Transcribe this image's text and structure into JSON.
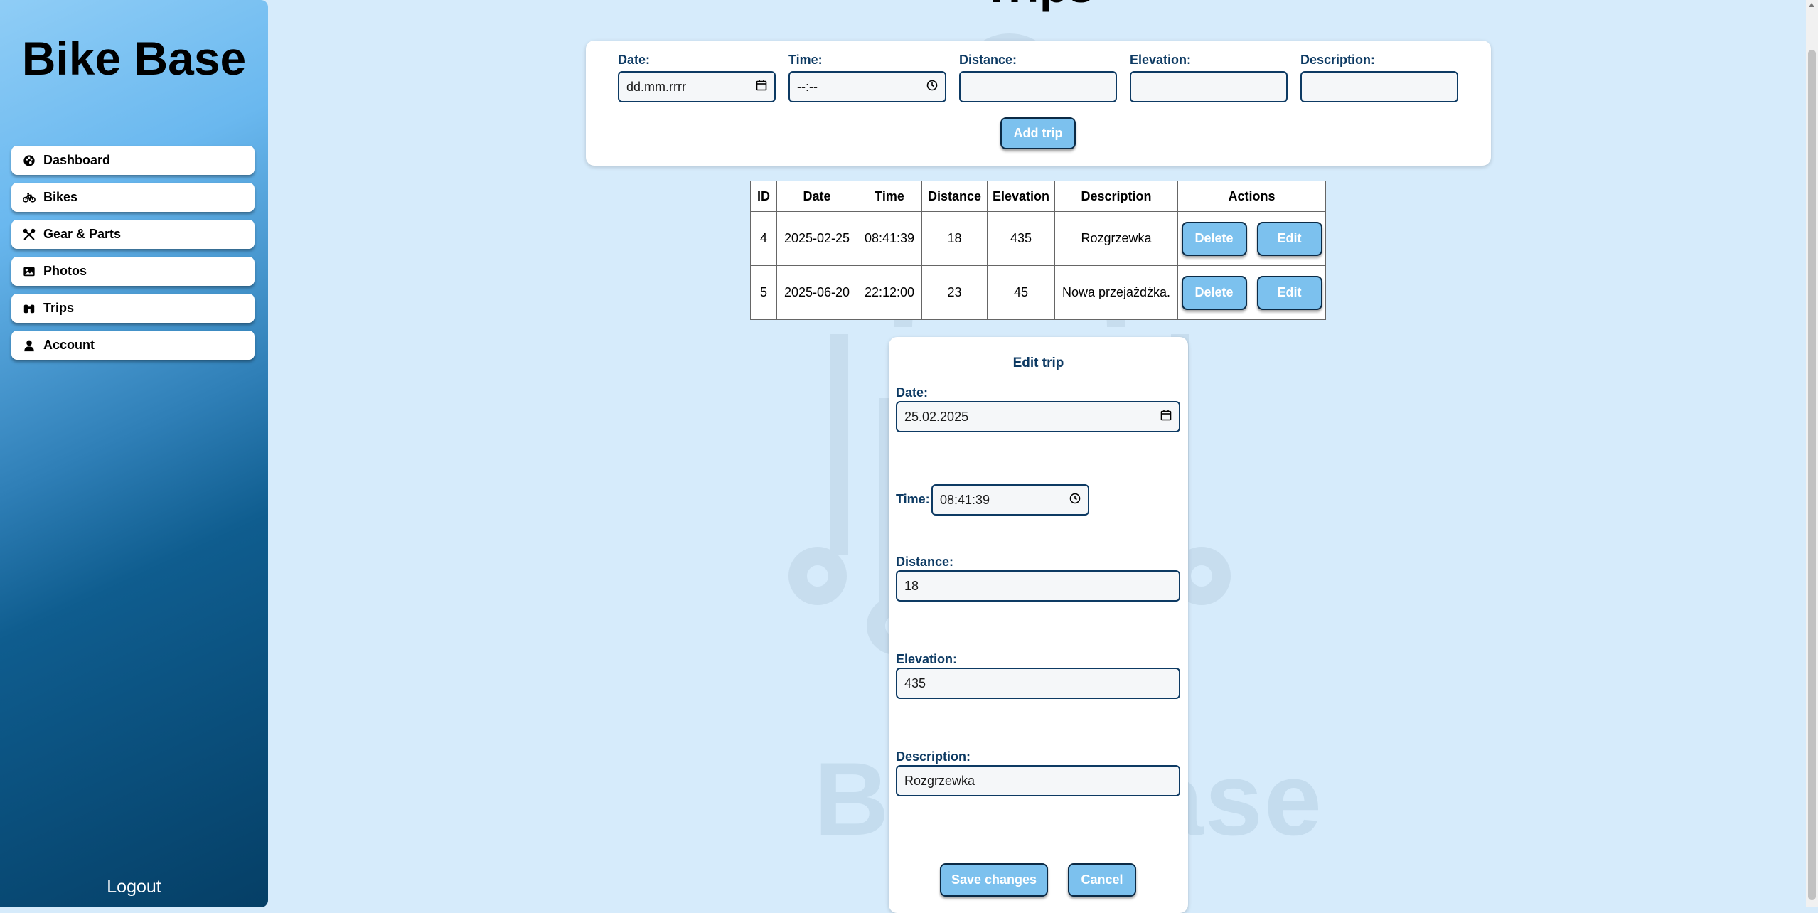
{
  "app": {
    "brand": "Bike Base",
    "page_title": "Trips",
    "watermark_text": "Bike Base"
  },
  "sidebar": {
    "items": [
      {
        "label": "Dashboard",
        "icon": "palette-icon"
      },
      {
        "label": "Bikes",
        "icon": "bicycle-icon"
      },
      {
        "label": "Gear & Parts",
        "icon": "tools-icon"
      },
      {
        "label": "Photos",
        "icon": "image-icon"
      },
      {
        "label": "Trips",
        "icon": "binoculars-icon"
      },
      {
        "label": "Account",
        "icon": "user-icon"
      }
    ],
    "logout": "Logout"
  },
  "add_form": {
    "date_label": "Date:",
    "date_value": "dd.mm.rrrr",
    "time_label": "Time:",
    "time_value": "--:--",
    "distance_label": "Distance:",
    "distance_value": "",
    "elevation_label": "Elevation:",
    "elevation_value": "",
    "description_label": "Description:",
    "description_value": "",
    "submit": "Add trip"
  },
  "table": {
    "headers": [
      "ID",
      "Date",
      "Time",
      "Distance",
      "Elevation",
      "Description",
      "Actions"
    ],
    "rows": [
      {
        "id": "4",
        "date": "2025-02-25",
        "time": "08:41:39",
        "distance": "18",
        "elevation": "435",
        "description": "Rozgrzewka"
      },
      {
        "id": "5",
        "date": "2025-06-20",
        "time": "22:12:00",
        "distance": "23",
        "elevation": "45",
        "description": "Nowa przejażdżka."
      }
    ],
    "delete_label": "Delete",
    "edit_label": "Edit"
  },
  "edit_form": {
    "title": "Edit trip",
    "date_label": "Date:",
    "date_value": "25.02.2025",
    "time_label": "Time:",
    "time_value": "08:41:39",
    "distance_label": "Distance:",
    "distance_value": "18",
    "elevation_label": "Elevation:",
    "elevation_value": "435",
    "description_label": "Description:",
    "description_value": "Rozgrzewka",
    "save": "Save changes",
    "cancel": "Cancel"
  },
  "colors": {
    "accent": "#7cc1ee",
    "dark": "#0d3a63",
    "background": "#d6ebfb"
  }
}
